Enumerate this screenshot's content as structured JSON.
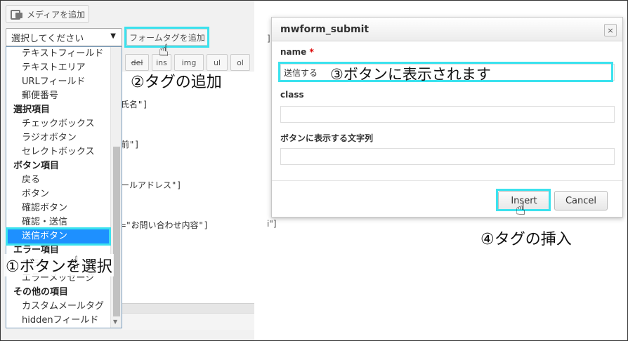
{
  "editor": {
    "media_button": "メディアを追加",
    "select_current": "選択してください",
    "form_tag_button": "フォームタグを追加",
    "quicktags": [
      "del",
      "ins",
      "img",
      "ul",
      "ol"
    ],
    "code_lines": [
      "氏名\"]",
      "前\"]",
      "ールアドレス\"]",
      "=\"お問い合わせ内容\"]"
    ],
    "stray_right": "]",
    "stray_right2": "i\"]"
  },
  "dropdown": {
    "items": [
      {
        "type": "option",
        "label": "テキストフィールド"
      },
      {
        "type": "option",
        "label": "テキストエリア"
      },
      {
        "type": "option",
        "label": "URLフィールド"
      },
      {
        "type": "option",
        "label": "郵便番号"
      },
      {
        "type": "group",
        "label": "選択項目"
      },
      {
        "type": "option",
        "label": "チェックボックス"
      },
      {
        "type": "option",
        "label": "ラジオボタン"
      },
      {
        "type": "option",
        "label": "セレクトボックス"
      },
      {
        "type": "group",
        "label": "ボタン項目"
      },
      {
        "type": "option",
        "label": "戻る"
      },
      {
        "type": "option",
        "label": "ボタン"
      },
      {
        "type": "option",
        "label": "確認ボタン"
      },
      {
        "type": "option",
        "label": "確認・送信"
      },
      {
        "type": "option",
        "label": "送信ボタン",
        "selected": true
      },
      {
        "type": "group",
        "label": "エラー項目"
      },
      {
        "type": "option",
        "label": "エラー"
      },
      {
        "type": "option",
        "label": "エラーメッセージ"
      },
      {
        "type": "group",
        "label": "その他の項目"
      },
      {
        "type": "option",
        "label": "カスタムメールタグ"
      },
      {
        "type": "option",
        "label": "hiddenフィールド"
      }
    ]
  },
  "dialog": {
    "title": "mwform_submit",
    "close_symbol": "×",
    "name_label": "name",
    "required_mark": "*",
    "name_value": "送信する",
    "class_label": "class",
    "class_value": "",
    "text_label": "ボタンに表示する文字列",
    "text_value": "",
    "insert_button": "Insert",
    "cancel_button": "Cancel"
  },
  "annotations": {
    "step1": "①ボタンを選択",
    "step2": "②タグの追加",
    "step3": "③ボタンに表示されます",
    "step4": "④タグの挿入"
  },
  "colors": {
    "highlight": "#3be2ee",
    "selected_option": "#1e90ff"
  }
}
